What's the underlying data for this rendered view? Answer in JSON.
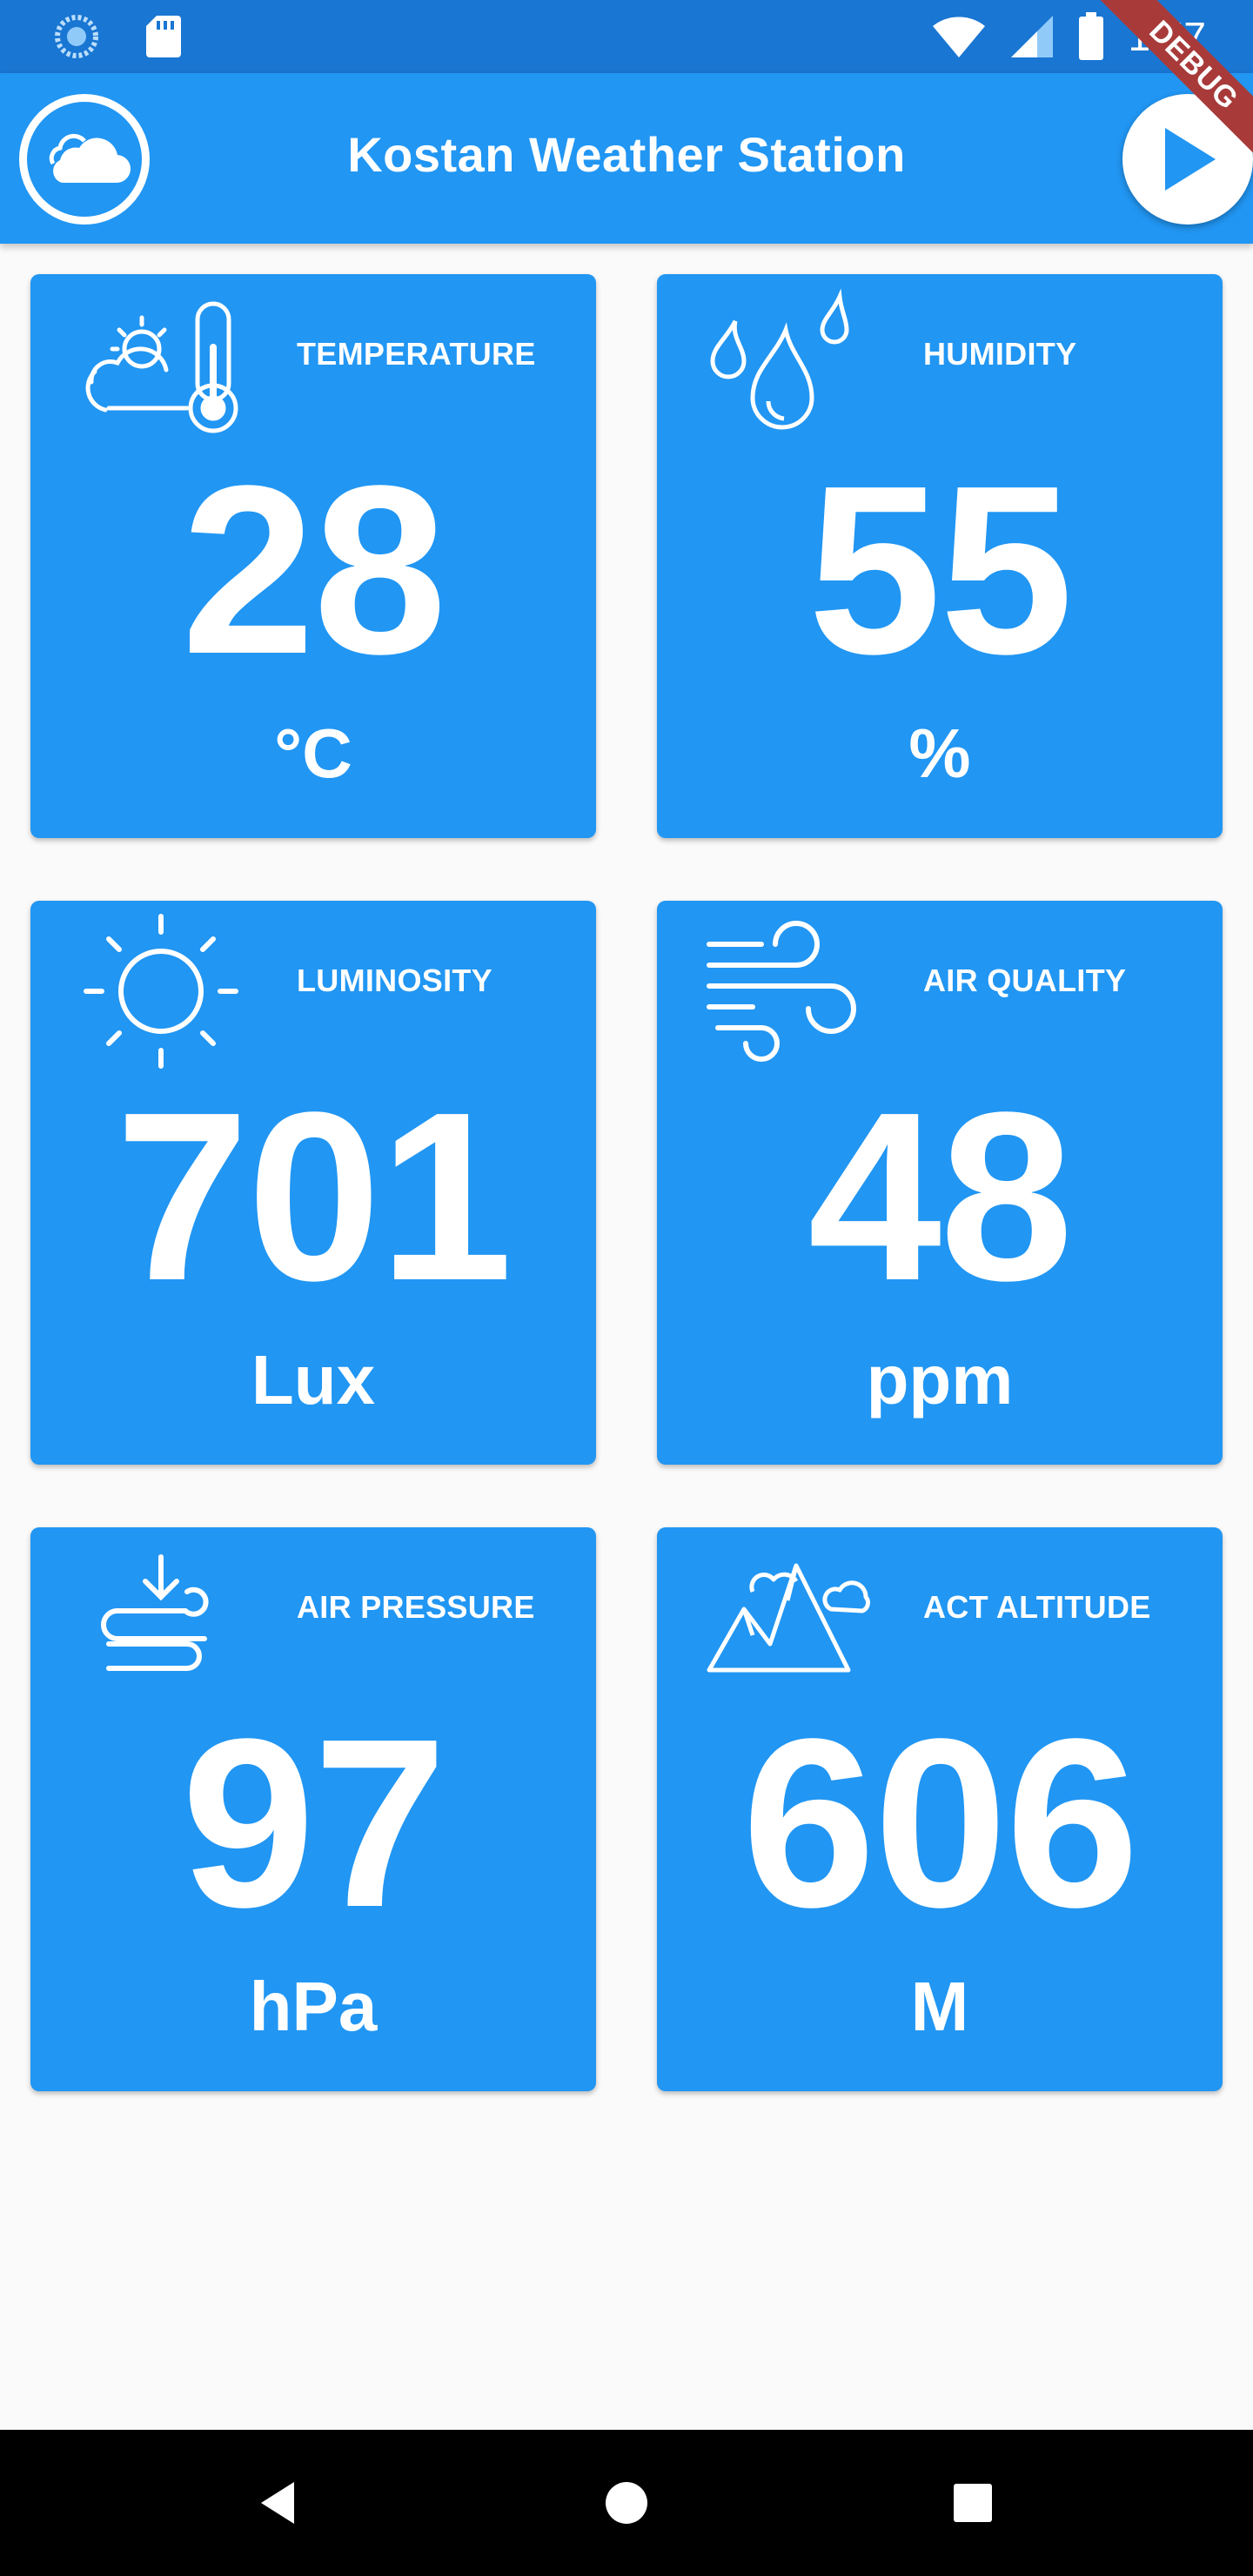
{
  "status_bar": {
    "time": "1:57",
    "icons": [
      "sync-icon",
      "sd-card-icon",
      "wifi-icon",
      "signal-icon",
      "battery-icon"
    ]
  },
  "app_bar": {
    "title": "Kostan Weather Station",
    "logo_icon": "cloud-icon",
    "action_icon": "play-icon"
  },
  "debug_banner": "DEBUG",
  "cards": [
    {
      "label": "TEMPERATURE",
      "value": "28",
      "unit": "°C",
      "icon": "temperature-icon"
    },
    {
      "label": "HUMIDITY",
      "value": "55",
      "unit": "%",
      "icon": "humidity-icon"
    },
    {
      "label": "LUMINOSITY",
      "value": "701",
      "unit": "Lux",
      "icon": "sun-icon"
    },
    {
      "label": "AIR QUALITY",
      "value": "48",
      "unit": "ppm",
      "icon": "wind-icon"
    },
    {
      "label": "AIR PRESSURE",
      "value": "97",
      "unit": "hPa",
      "icon": "air-pressure-icon"
    },
    {
      "label": "ACT ALTITUDE",
      "value": "606",
      "unit": "M",
      "icon": "mountain-icon"
    }
  ],
  "nav_bar": {
    "icons": [
      "back-icon",
      "home-icon",
      "recents-icon"
    ]
  },
  "colors": {
    "primary": "#2196f3",
    "status_bar": "#1976d2",
    "background": "#fafafa",
    "text_on_primary": "#ffffff",
    "debug_banner": "#a83a3a"
  }
}
